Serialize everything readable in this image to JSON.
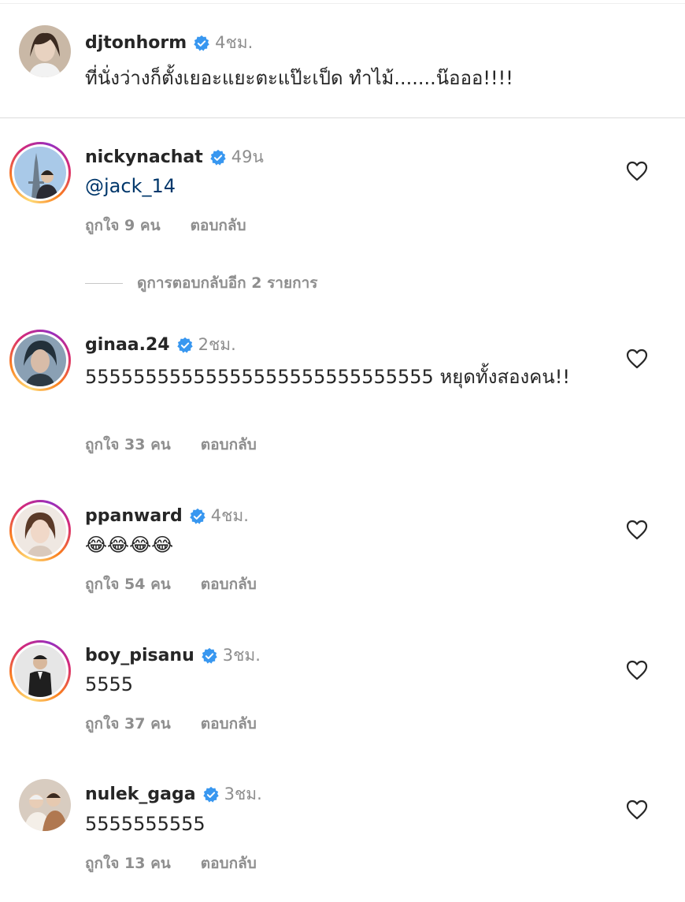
{
  "caption": {
    "username": "djtonhorm",
    "time": "4ชม.",
    "text": "ที่นั่งว่างก็ตั้งเยอะแยะตะแป๊ะเป็ด ทำไม้.......น๊อออ!!!!"
  },
  "view_more_replies": "ดูการตอบกลับอีก 2 รายการ",
  "comments": [
    {
      "username": "nickynachat",
      "time": "49น",
      "text": "@jack_14",
      "likes": "ถูกใจ 9 คน",
      "reply": "ตอบกลับ"
    },
    {
      "username": "ginaa.24",
      "time": "2ชม.",
      "text": "55555555555555555555555555555 หยุดทั้งสองคน!!",
      "likes": "ถูกใจ 33 คน",
      "reply": "ตอบกลับ"
    },
    {
      "username": "ppanward",
      "time": "4ชม.",
      "text": "😂😂😂😂",
      "likes": "ถูกใจ 54 คน",
      "reply": "ตอบกลับ"
    },
    {
      "username": "boy_pisanu",
      "time": "3ชม.",
      "text": "5555",
      "likes": "ถูกใจ 37 คน",
      "reply": "ตอบกลับ"
    },
    {
      "username": "nulek_gaga",
      "time": "3ชม.",
      "text": "5555555555",
      "likes": "ถูกใจ 13 คน",
      "reply": "ตอบกลับ"
    }
  ],
  "colors": {
    "verified": "#3897f0",
    "mention": "#00376b",
    "secondary_text": "#8e8e8e"
  }
}
